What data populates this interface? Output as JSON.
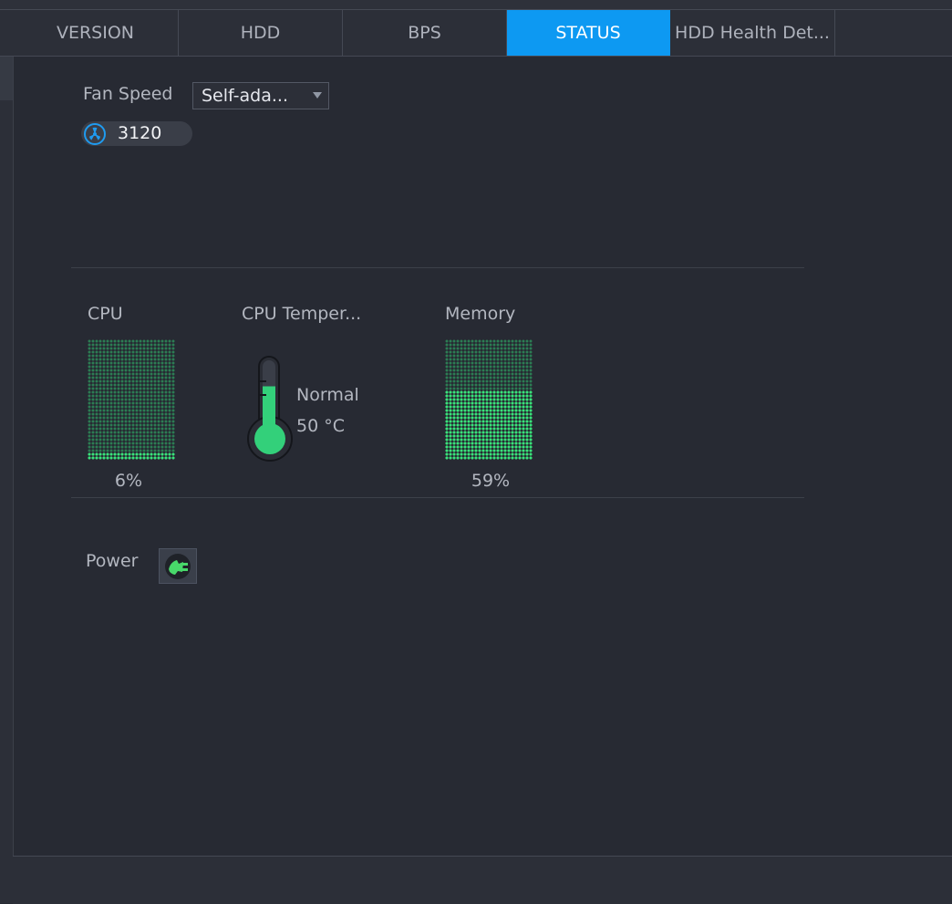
{
  "tabs": [
    {
      "label": "VERSION",
      "active": false
    },
    {
      "label": "HDD",
      "active": false
    },
    {
      "label": "BPS",
      "active": false
    },
    {
      "label": "STATUS",
      "active": true
    },
    {
      "label": "HDD Health Det..."
    }
  ],
  "fan": {
    "label": "Fan Speed",
    "mode": "Self-ada...",
    "rpm": "3120",
    "icon": "fan-icon"
  },
  "cpu": {
    "label": "CPU",
    "usage": "6%",
    "usage_value": 6
  },
  "temperature": {
    "label": "CPU Temper...",
    "status": "Normal",
    "value": "50 °C",
    "level_percent": 68
  },
  "memory": {
    "label": "Memory",
    "usage": "59%",
    "usage_value": 59
  },
  "power": {
    "label": "Power",
    "icon": "power-plug-icon"
  },
  "colors": {
    "accent": "#0d99f2",
    "meter_on": "#39e37a",
    "meter_off": "#2c7d53",
    "background": "#272a33"
  }
}
